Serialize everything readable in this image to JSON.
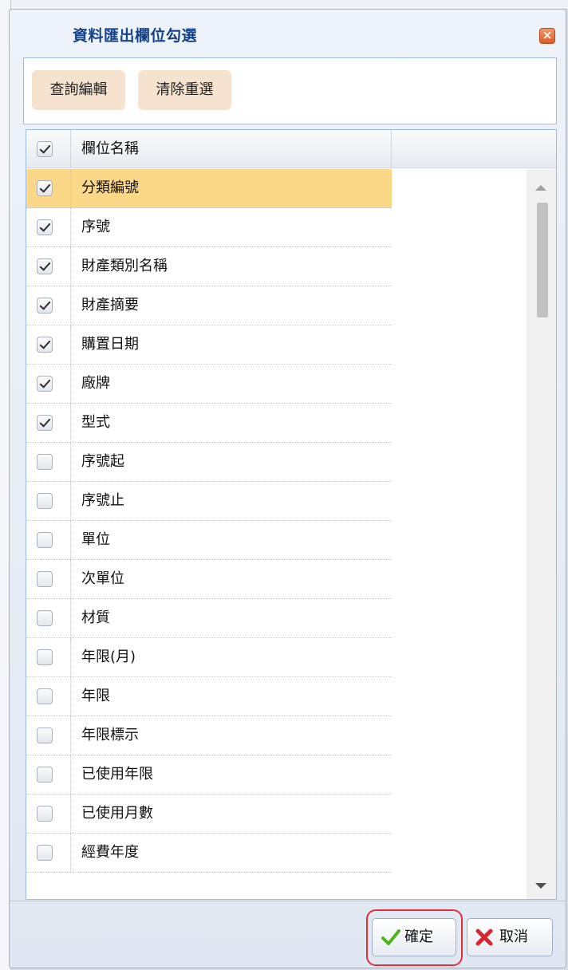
{
  "dialog": {
    "title": "資料匯出欄位勾選",
    "close_icon": "close-icon"
  },
  "toolbar": {
    "query_edit_label": "查詢編輯",
    "clear_reselect_label": "清除重選"
  },
  "grid": {
    "header": {
      "column_name": "欄位名稱",
      "select_all_checked": true
    },
    "rows": [
      {
        "label": "分類編號",
        "checked": true,
        "selected": true
      },
      {
        "label": "序號",
        "checked": true
      },
      {
        "label": "財產類別名稱",
        "checked": true
      },
      {
        "label": "財產摘要",
        "checked": true
      },
      {
        "label": "購置日期",
        "checked": true
      },
      {
        "label": "廠牌",
        "checked": true
      },
      {
        "label": "型式",
        "checked": true
      },
      {
        "label": "序號起",
        "checked": false
      },
      {
        "label": "序號止",
        "checked": false
      },
      {
        "label": "單位",
        "checked": false
      },
      {
        "label": "次單位",
        "checked": false
      },
      {
        "label": "材質",
        "checked": false
      },
      {
        "label": "年限(月)",
        "checked": false
      },
      {
        "label": "年限",
        "checked": false
      },
      {
        "label": "年限標示",
        "checked": false
      },
      {
        "label": "已使用年限",
        "checked": false
      },
      {
        "label": "已使用月數",
        "checked": false
      },
      {
        "label": "經費年度",
        "checked": false
      }
    ]
  },
  "footer": {
    "confirm_label": "確定",
    "cancel_label": "取消",
    "confirm_icon": "checkmark-icon",
    "cancel_icon": "x-icon"
  },
  "colors": {
    "title": "#15428b",
    "selected_row": "#fbd788",
    "highlight_ring": "#e0303a",
    "toolbar_button": "#f6e3cf"
  }
}
